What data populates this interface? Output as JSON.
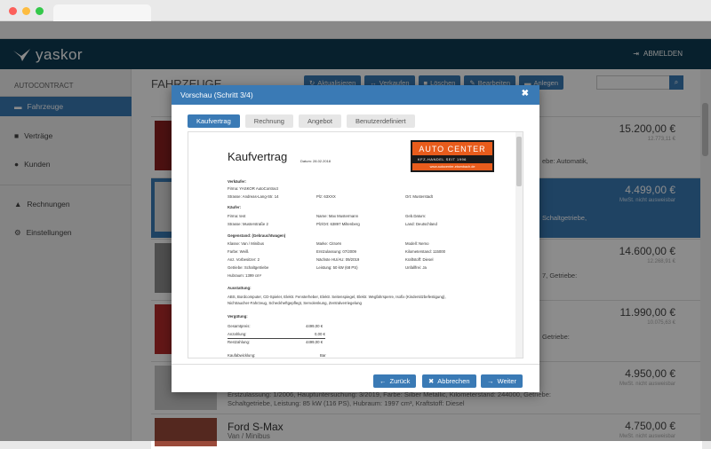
{
  "brand": {
    "logo": "yaskor"
  },
  "header": {
    "logout": "ABMELDEN"
  },
  "sidebar": {
    "section": "AUTOCONTRACT",
    "items": [
      {
        "label": "Fahrzeuge",
        "icon": "car-icon",
        "active": true
      },
      {
        "label": "Verträge",
        "icon": "file-icon"
      },
      {
        "label": "Kunden",
        "icon": "users-icon"
      },
      {
        "label": "Rechnungen",
        "icon": "bank-icon"
      },
      {
        "label": "Einstellungen",
        "icon": "gears-icon"
      }
    ]
  },
  "main": {
    "title": "FAHRZEUGE",
    "toolbar": [
      "Aktualisieren",
      "Verkaufen",
      "Löschen",
      "Bearbeiten",
      "Anlegen"
    ],
    "list": [
      {
        "price": "15.200,00 €",
        "sub": "12.773,11 €",
        "peek": "ebe: Automatik,"
      },
      {
        "price": "4.499,00 €",
        "sub": "MwSt. nicht ausweisbar",
        "peek": "Schaltgetriebe,",
        "selected": true
      },
      {
        "price": "14.600,00 €",
        "sub": "12.268,91 €",
        "peek": "7, Getriebe:"
      },
      {
        "price": "11.990,00 €",
        "sub": "10.075,63 €",
        "peek": "Getriebe:"
      },
      {
        "price": "4.950,00 €",
        "sub": "MwSt. nicht ausweisbar",
        "detail1": "Erstzulassung: 1/2006, Hauptuntersuchung: 3/2019, Farbe: Silber Metallic, Kilometerstand: 244000, Getriebe:",
        "detail2": "Schaltgetriebe, Leistung: 85 kW (116 PS), Hubraum: 1997 cm³, Kraftstoff: Diesel"
      },
      {
        "name": "Ford S-Max",
        "type": "Van / Minibus",
        "price": "4.750,00 €",
        "sub": "MwSt. nicht ausweisbar"
      }
    ]
  },
  "modal": {
    "title": "Vorschau (Schritt 3/4)",
    "tabs": [
      "Kaufvertrag",
      "Rechnung",
      "Angebot",
      "Benutzerdefiniert"
    ],
    "footer": {
      "back": "Zurück",
      "cancel": "Abbrechen",
      "next": "Weiter"
    }
  },
  "document": {
    "title": "Kaufvertrag",
    "date": "Datum: 28.02.2018",
    "logo": {
      "top": "AUTO CENTER",
      "mid": "KFZ-HANDEL SEIT 1996",
      "bottom": "www.autocenter-eisenbach.de"
    },
    "seller_h": "Verkäufer:",
    "seller": {
      "firma": "Firma: YASKOR AutoContract",
      "strasse": "Strasse: Andreas-Lang-Str. 14",
      "plz": "Plz: 63XXX",
      "ort": "Ort: Musterstadt"
    },
    "buyer_h": "Käufer:",
    "buyer": {
      "firma": "Firma: test",
      "name": "Name: Max Mustermann",
      "geb": "Geb.Datum:",
      "strasse": "Strasse: Musterstraße 2",
      "plz": "Plz/Ort: 63897 Miltenberg",
      "land": "Land: Deutschland"
    },
    "vehicle_h": "Gegenstand: (Gebrauchtwagen)",
    "vehicle": {
      "klasse": "Klasse: Van / Minibus",
      "marke": "Marke: Citroën",
      "modell": "Modell: Nemo",
      "farbe": "Farbe: Weiß",
      "ez": "Erstzulassung: 07/2009",
      "km": "Kilometerstand: 115000",
      "vorbesitzer": "Anz. Vorbesitzer: 2",
      "hu": "Nächste HU/AU: 09/2019",
      "kraftstoff": "Kraftstoff: Diesel",
      "getriebe": "Getriebe: Schaltgetriebe",
      "leistung": "Leistung: 50 kW (68 PS)",
      "unfall": "Unfallfrei: Ja",
      "hubraum": "Hubraum: 1399 cm³"
    },
    "equip_h": "Ausstattung:",
    "equip1": "ABS, Bordcomputer, CD-Spieler, Elektr. Fensterheber, Elektr. Seitenspiegel, Elektr. Wegfahrsperre, Isofix (Kindersitzbefestigung),",
    "equip2": "Nichtraucher-Fahrzeug, Scheckheftgepflegt, Servolenkung, Zentralverriegelung",
    "pay_h": "Vergütung:",
    "pay": [
      {
        "label": "Gesamtpreis:",
        "value": "4499,00 €"
      },
      {
        "label": "Anzahlung:",
        "value": "0,00 €"
      },
      {
        "label": "Restzahlung:",
        "value": "4499,00 €"
      }
    ],
    "kauf_label": "Kaufabwicklung:",
    "kauf_value": "Bar"
  }
}
